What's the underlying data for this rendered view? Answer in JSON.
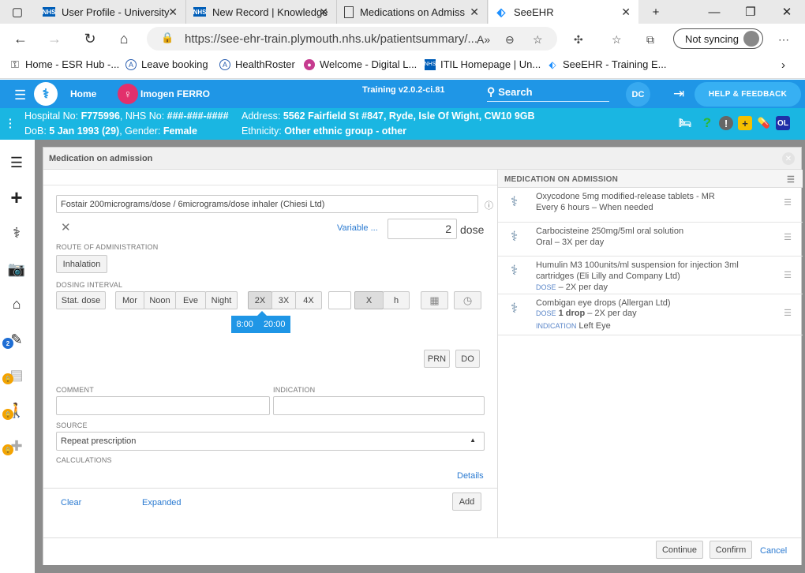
{
  "browser": {
    "tabs": [
      {
        "label": "User Profile - University",
        "icon": "nhs"
      },
      {
        "label": "New Record | Knowledge",
        "icon": "nhs"
      },
      {
        "label": "Medications on Admiss",
        "icon": "doc"
      },
      {
        "label": "SeeEHR",
        "icon": "drop"
      }
    ],
    "url": "https://see-ehr-train.plymouth.nhs.uk/patientsummary/...",
    "sync_label": "Not syncing",
    "favorites": [
      {
        "label": "Home - ESR Hub -...",
        "icon": "esr"
      },
      {
        "label": "Leave booking",
        "icon": "leave"
      },
      {
        "label": "HealthRoster",
        "icon": "roster"
      },
      {
        "label": "Welcome - Digital L...",
        "icon": "digital"
      },
      {
        "label": "ITIL Homepage | Un...",
        "icon": "nhs"
      },
      {
        "label": "SeeEHR - Training E...",
        "icon": "drop"
      }
    ]
  },
  "app": {
    "home_label": "Home",
    "patient_name": "Imogen FERRO",
    "version": "Training v2.0.2-ci.81",
    "search_label": "Search",
    "user_initials": "DC",
    "help_label": "HELP & FEEDBACK",
    "patient": {
      "hospital_prefix": "Hospital No: ",
      "hospital_no": "F775996",
      "nhs_prefix": ", NHS No: ",
      "nhs_no": "###-###-####",
      "address_prefix": "Address: ",
      "address": "5562 Fairfield St #847, Ryde, Isle Of Wight, CW10 9GB",
      "dob_prefix": "DoB: ",
      "dob": "5 Jan 1993 (29)",
      "gender_prefix": ", Gender: ",
      "gender": "Female",
      "ethnicity_prefix": "Ethnicity: ",
      "ethnicity": "Other ethnic group - other",
      "badge": "OL"
    },
    "sidebar_badge": "2"
  },
  "modal": {
    "title": "Medication on admission",
    "drug": "Fostair 200micrograms/dose / 6micrograms/dose inhaler (Chiesi Ltd)",
    "variable_label": "Variable ...",
    "dose_value": "2",
    "dose_unit": "dose",
    "route_label": "ROUTE OF ADMINISTRATION",
    "route_value": "Inhalation",
    "interval_label": "DOSING INTERVAL",
    "stat_label": "Stat. dose",
    "times_of_day": [
      "Mor",
      "Noon",
      "Eve",
      "Night"
    ],
    "frequency": [
      "2X",
      "3X",
      "4X"
    ],
    "custom_unit": [
      "X",
      "h"
    ],
    "times": [
      "8:00",
      "20:00"
    ],
    "prn_label": "PRN",
    "do_label": "DO",
    "comment_label": "COMMENT",
    "indication_label": "INDICATION",
    "source_label": "SOURCE",
    "source_value": "Repeat prescription",
    "calculations_label": "CALCULATIONS",
    "details_label": "Details",
    "clear_label": "Clear",
    "expanded_label": "Expanded",
    "add_label": "Add",
    "continue_label": "Continue",
    "confirm_label": "Confirm",
    "cancel_label": "Cancel",
    "list_header": "MEDICATION ON ADMISSION",
    "medications": [
      {
        "name": "Oxycodone 5mg modified-release tablets - MR",
        "detail": "Every 6 hours – When needed"
      },
      {
        "name": "Carbocisteine 250mg/5ml oral solution",
        "detail": "Oral – 3X per day"
      },
      {
        "name": "Humulin M3 100units/ml suspension for injection 3ml cartridges (Eli Lilly and Company Ltd)",
        "dose_label": "DOSE",
        "detail": " – 2X per day"
      },
      {
        "name": "Combigan eye drops (Allergan Ltd)",
        "dose_label": "DOSE",
        "dose_amount": "1 drop",
        "detail": " – 2X per day",
        "indication_label": "INDICATION",
        "indication": "Left Eye"
      }
    ]
  }
}
